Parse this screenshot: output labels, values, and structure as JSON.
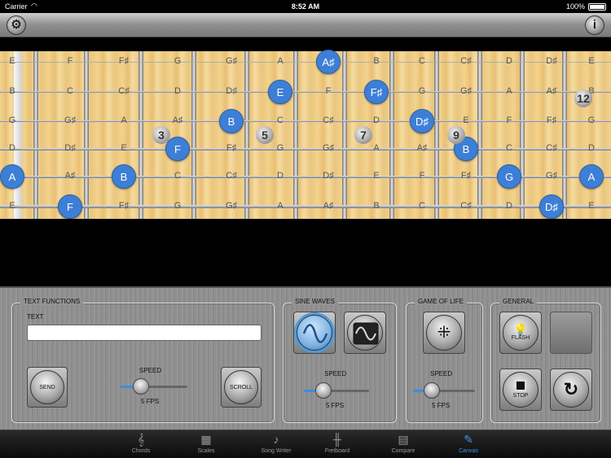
{
  "status_bar": {
    "carrier": "Carrier",
    "time": "8:52 AM",
    "battery": "100%"
  },
  "toolbar": {
    "settings_icon": "gears-icon",
    "info_label": "i"
  },
  "fretboard": {
    "strings": [
      {
        "notes": [
          "E",
          "F",
          "F♯",
          "G",
          "G♯",
          "A",
          "A♯",
          "B",
          "C",
          "C♯",
          "D",
          "D♯",
          "E"
        ]
      },
      {
        "notes": [
          "B",
          "C",
          "C♯",
          "D",
          "D♯",
          "E",
          "F",
          "F♯",
          "G",
          "G♯",
          "A",
          "A♯",
          "B"
        ]
      },
      {
        "notes": [
          "G",
          "G♯",
          "A",
          "A♯",
          "B",
          "C",
          "C♯",
          "D",
          "D♯",
          "E",
          "F",
          "F♯",
          "G"
        ]
      },
      {
        "notes": [
          "D",
          "D♯",
          "E",
          "F",
          "F♯",
          "G",
          "G♯",
          "A",
          "A♯",
          "B",
          "C",
          "C♯",
          "D"
        ]
      },
      {
        "notes": [
          "A",
          "A♯",
          "B",
          "C",
          "C♯",
          "D",
          "D♯",
          "E",
          "F",
          "F♯",
          "G",
          "G♯",
          "A"
        ]
      },
      {
        "notes": [
          "E",
          "F",
          "F♯",
          "G",
          "G♯",
          "A",
          "A♯",
          "B",
          "C",
          "C♯",
          "D",
          "D♯",
          "E"
        ]
      }
    ],
    "highlighted": [
      {
        "string": 0,
        "fret": 6,
        "label": "A♯"
      },
      {
        "string": 1,
        "fret": 5,
        "label": "E"
      },
      {
        "string": 1,
        "fret": 7,
        "label": "F♯"
      },
      {
        "string": 2,
        "fret": 4,
        "label": "B"
      },
      {
        "string": 2,
        "fret": 8,
        "label": "D♯"
      },
      {
        "string": 3,
        "fret": 3,
        "label": "F"
      },
      {
        "string": 3,
        "fret": 9,
        "label": "B"
      },
      {
        "string": 4,
        "fret": 0,
        "label": "A"
      },
      {
        "string": 4,
        "fret": 2,
        "label": "B"
      },
      {
        "string": 4,
        "fret": 10,
        "label": "G"
      },
      {
        "string": 4,
        "fret": 12,
        "label": "A"
      },
      {
        "string": 5,
        "fret": 1,
        "label": "F"
      },
      {
        "string": 5,
        "fret": 11,
        "label": "D♯"
      }
    ],
    "position_markers": [
      "3",
      "5",
      "7",
      "9",
      "12"
    ]
  },
  "text_functions": {
    "title": "TEXT FUNCTIONS",
    "text_label": "TEXT",
    "text_value": "",
    "send_label": "SEND",
    "scroll_label": "SCROLL",
    "speed_label": "SPEED",
    "speed_value": "5 FPS",
    "speed_level": 0.3
  },
  "sine_waves": {
    "title": "SINE WAVES",
    "speed_label": "SPEED",
    "speed_value": "5 FPS",
    "speed_level": 0.3
  },
  "game_of_life": {
    "title": "GAME OF LIFE",
    "speed_label": "SPEED",
    "speed_value": "5 FPS",
    "speed_level": 0.3
  },
  "general": {
    "title": "GENERAL",
    "flash_label": "FLASH",
    "stop_label": "STOP"
  },
  "tabs": [
    {
      "label": "Chords",
      "icon": "guitar-icon"
    },
    {
      "label": "Scales",
      "icon": "scales-grid-icon"
    },
    {
      "label": "Song Writer",
      "icon": "treble-clef-icon"
    },
    {
      "label": "Fretboard",
      "icon": "fretboard-icon"
    },
    {
      "label": "Compare",
      "icon": "compare-icon"
    },
    {
      "label": "Canvas",
      "icon": "brush-icon"
    }
  ],
  "colors": {
    "accent": "#3a94ea",
    "note_dot": "#3d7fd6"
  }
}
